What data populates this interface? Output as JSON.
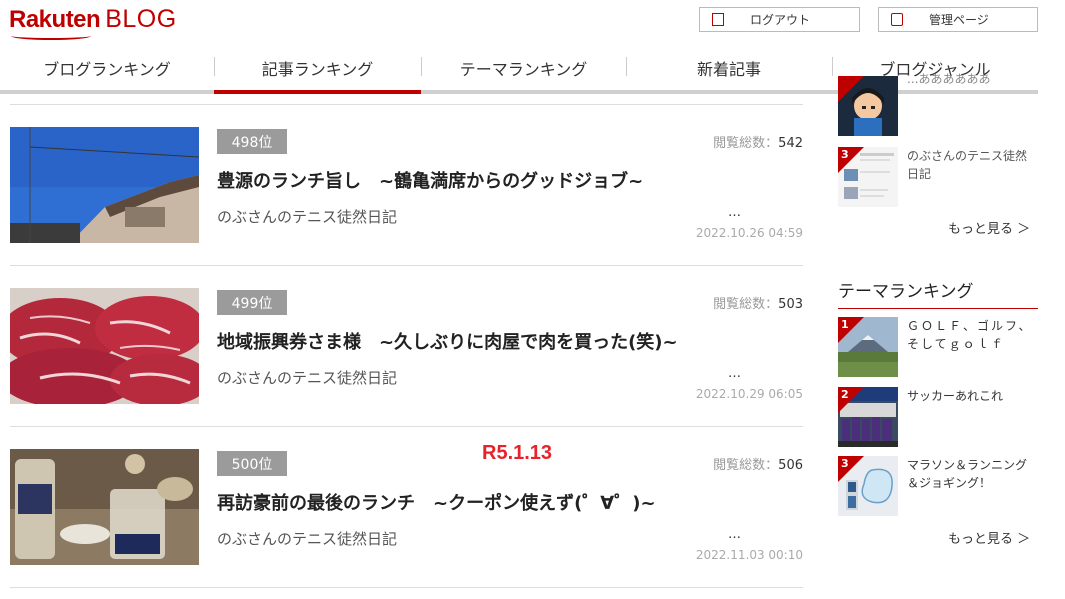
{
  "header": {
    "logo_brand": "Rakuten",
    "logo_sub": "BLOG",
    "logout_label": "ログアウト",
    "admin_label": "管理ページ"
  },
  "nav": {
    "tabs": [
      {
        "label": "ブログランキング",
        "active": false
      },
      {
        "label": "記事ランキング",
        "active": true
      },
      {
        "label": "テーマランキング",
        "active": false
      },
      {
        "label": "新着記事",
        "active": false
      },
      {
        "label": "ブログジャンル",
        "active": false
      }
    ]
  },
  "articles": [
    {
      "rank": "498位",
      "views_label": "閲覧総数：",
      "views": "542",
      "title": "豊源のランチ旨し　~鶴亀満席からのグッドジョブ~",
      "author": "のぶさんのテニス徒然日記",
      "more": "…",
      "date": "2022.10.26 04:59"
    },
    {
      "rank": "499位",
      "views_label": "閲覧総数：",
      "views": "503",
      "title": "地域振興券さま様　~久しぶりに肉屋で肉を買った(笑)~",
      "author": "のぶさんのテニス徒然日記",
      "more": "…",
      "date": "2022.10.29 06:05"
    },
    {
      "rank": "500位",
      "views_label": "閲覧総数：",
      "views": "506",
      "title": "再訪豪前の最後のランチ　~クーポン使えず(゜∀゜)~",
      "author": "のぶさんのテニス徒然日記",
      "more": "…",
      "date": "2022.11.03 00:10"
    }
  ],
  "annotation": "R5.1.13",
  "sidebar": {
    "blog_ranking": [
      {
        "num": "",
        "text": "...ああああああ"
      },
      {
        "num": "3",
        "text": "のぶさんのテニス徒然日記"
      }
    ],
    "more_label": "もっと見る ＞",
    "theme_heading": "テーマランキング",
    "theme_ranking": [
      {
        "num": "1",
        "text": "ＧＯＬＦ、ゴルフ、そしてｇｏｌｆ"
      },
      {
        "num": "2",
        "text": "サッカーあれこれ"
      },
      {
        "num": "3",
        "text": "マラソン＆ランニング＆ジョギング！"
      }
    ],
    "theme_more_label": "もっと見る ＞"
  },
  "colors": {
    "accent": "#bf0000",
    "rank_badge": "#9b9b9b",
    "annotation": "#e8212b"
  }
}
